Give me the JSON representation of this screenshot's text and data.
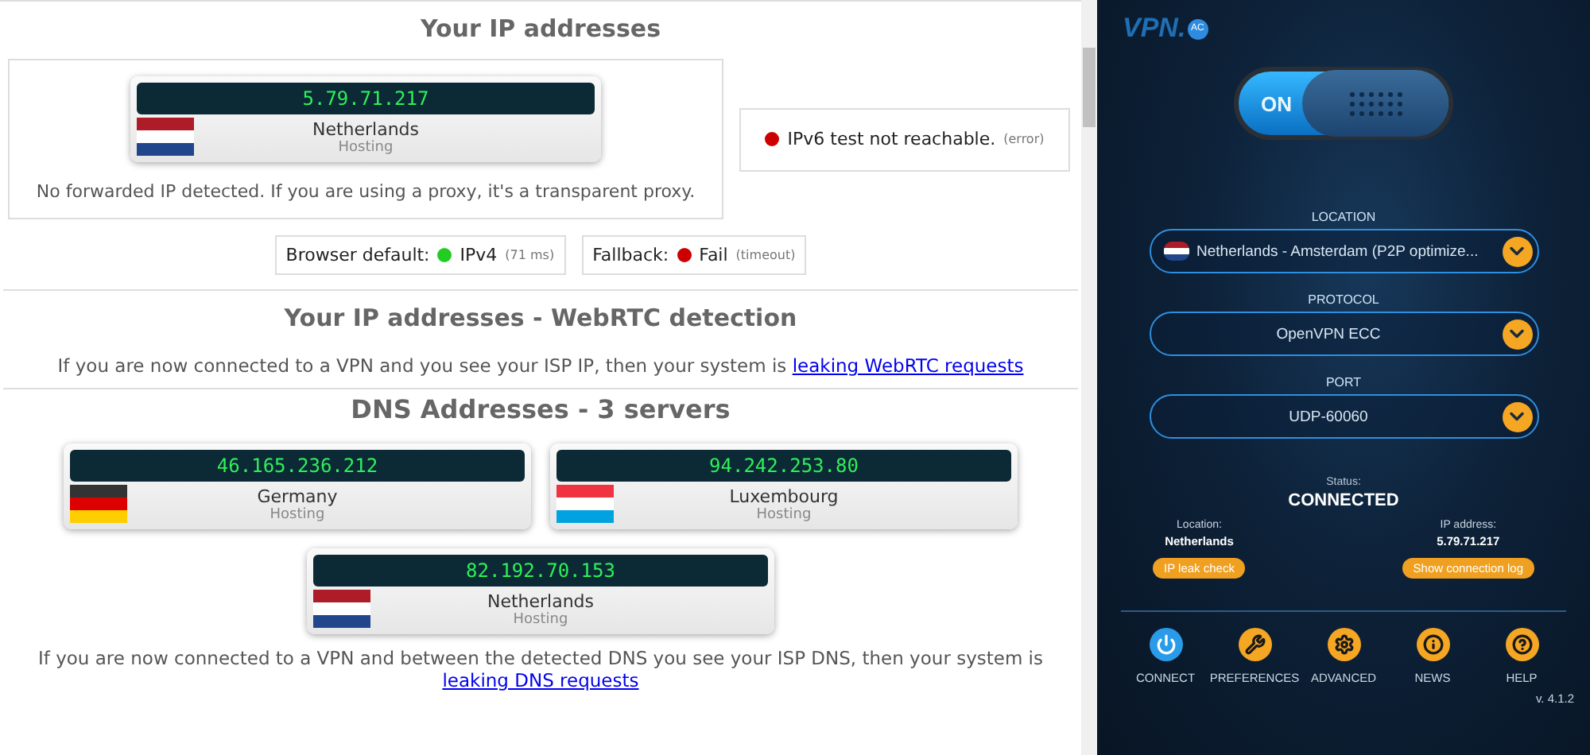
{
  "ip_section": {
    "title": "Your IP addresses",
    "main_ip": {
      "ip": "5.79.71.217",
      "country": "Netherlands",
      "type": "Hosting",
      "kind": "nl"
    },
    "forward_note": "No forwarded IP detected. If you are using a proxy, it's a transparent proxy.",
    "ipv6": {
      "color": "#cc0000",
      "text": "IPv6 test not reachable.",
      "note": "(error)"
    },
    "checks": [
      {
        "label": "Browser default:",
        "color": "#22cc22",
        "value": "IPv4",
        "note": "(71 ms)"
      },
      {
        "label": "Fallback:",
        "color": "#cc0000",
        "value": "Fail",
        "note": "(timeout)"
      }
    ]
  },
  "webrtc_section": {
    "title": "Your IP addresses - WebRTC detection",
    "text": "If you are now connected to a VPN and you see your ISP IP, then your system is",
    "link": "leaking WebRTC requests"
  },
  "dns_section": {
    "title": "DNS Addresses - 3 servers",
    "servers": [
      {
        "ip": "46.165.236.212",
        "country": "Germany",
        "type": "Hosting",
        "kind": "de"
      },
      {
        "ip": "94.242.253.80",
        "country": "Luxembourg",
        "type": "Hosting",
        "kind": "lu"
      },
      {
        "ip": "82.192.70.153",
        "country": "Netherlands",
        "type": "Hosting",
        "kind": "nl"
      }
    ],
    "text": "If you are now connected to a VPN and between the detected DNS you see your ISP DNS, then your system is",
    "link": "leaking DNS requests"
  },
  "app": {
    "logo": {
      "name": "VPN.",
      "badge": "AC"
    },
    "toggle": {
      "on": true,
      "label": "ON"
    },
    "selects": [
      {
        "label": "LOCATION",
        "value": "Netherlands - Amsterdam (P2P optimize...",
        "kind": "nl"
      },
      {
        "label": "PROTOCOL",
        "value": "OpenVPN ECC",
        "kind": "plain"
      },
      {
        "label": "PORT",
        "value": "UDP-60060",
        "kind": "plain"
      }
    ],
    "status_label": "Status:",
    "status": "CONNECTED",
    "details": [
      {
        "label": "Location:",
        "value": "Netherlands",
        "button": "IP leak check"
      },
      {
        "label": "IP address:",
        "value": "5.79.71.217",
        "button": "Show connection log"
      }
    ],
    "nav": [
      {
        "kind": "power",
        "label": "CONNECT",
        "selected": true
      },
      {
        "kind": "wrench",
        "label": "PREFERENCES",
        "selected": false
      },
      {
        "kind": "gear",
        "label": "ADVANCED",
        "selected": false
      },
      {
        "kind": "info",
        "label": "NEWS",
        "selected": false
      },
      {
        "kind": "help",
        "label": "HELP",
        "selected": false
      }
    ],
    "version": "v. 4.1.2"
  }
}
